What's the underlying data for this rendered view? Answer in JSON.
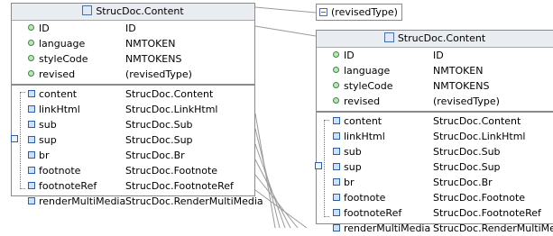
{
  "left_panel": {
    "title": "StrucDoc.Content",
    "attributes": [
      {
        "name": "ID",
        "type": "ID"
      },
      {
        "name": "language",
        "type": "NMTOKEN"
      },
      {
        "name": "styleCode",
        "type": "NMTOKENS"
      },
      {
        "name": "revised",
        "type": "(revisedType)"
      }
    ],
    "elements": [
      {
        "name": "content",
        "type": "StrucDoc.Content"
      },
      {
        "name": "linkHtml",
        "type": "StrucDoc.LinkHtml"
      },
      {
        "name": "sub",
        "type": "StrucDoc.Sub"
      },
      {
        "name": "sup",
        "type": "StrucDoc.Sup"
      },
      {
        "name": "br",
        "type": "StrucDoc.Br"
      },
      {
        "name": "footnote",
        "type": "StrucDoc.Footnote"
      },
      {
        "name": "footnoteRef",
        "type": "StrucDoc.FootnoteRef"
      },
      {
        "name": "renderMultiMedia",
        "type": "StrucDoc.RenderMultiMedia"
      }
    ]
  },
  "revised_type_box": {
    "label": "(revisedType)"
  },
  "right_panel": {
    "title": "StrucDoc.Content",
    "attributes": [
      {
        "name": "ID",
        "type": "ID"
      },
      {
        "name": "language",
        "type": "NMTOKEN"
      },
      {
        "name": "styleCode",
        "type": "NMTOKENS"
      },
      {
        "name": "revised",
        "type": "(revisedType)"
      }
    ],
    "elements": [
      {
        "name": "content",
        "type": "StrucDoc.Content"
      },
      {
        "name": "linkHtml",
        "type": "StrucDoc.LinkHtml"
      },
      {
        "name": "sub",
        "type": "StrucDoc.Sub"
      },
      {
        "name": "sup",
        "type": "StrucDoc.Sup"
      },
      {
        "name": "br",
        "type": "StrucDoc.Br"
      },
      {
        "name": "footnote",
        "type": "StrucDoc.Footnote"
      },
      {
        "name": "footnoteRef",
        "type": "StrucDoc.FootnoteRef"
      },
      {
        "name": "renderMultiMedia",
        "type": "StrucDoc.RenderMultiMedia"
      }
    ]
  },
  "icons": {
    "title_icon": "complex-type-icon",
    "attribute_icon": "attribute-icon",
    "element_icon": "element-icon",
    "sequence_icon": "sequence-icon",
    "collapse_icon": "collapse-minus-icon"
  }
}
